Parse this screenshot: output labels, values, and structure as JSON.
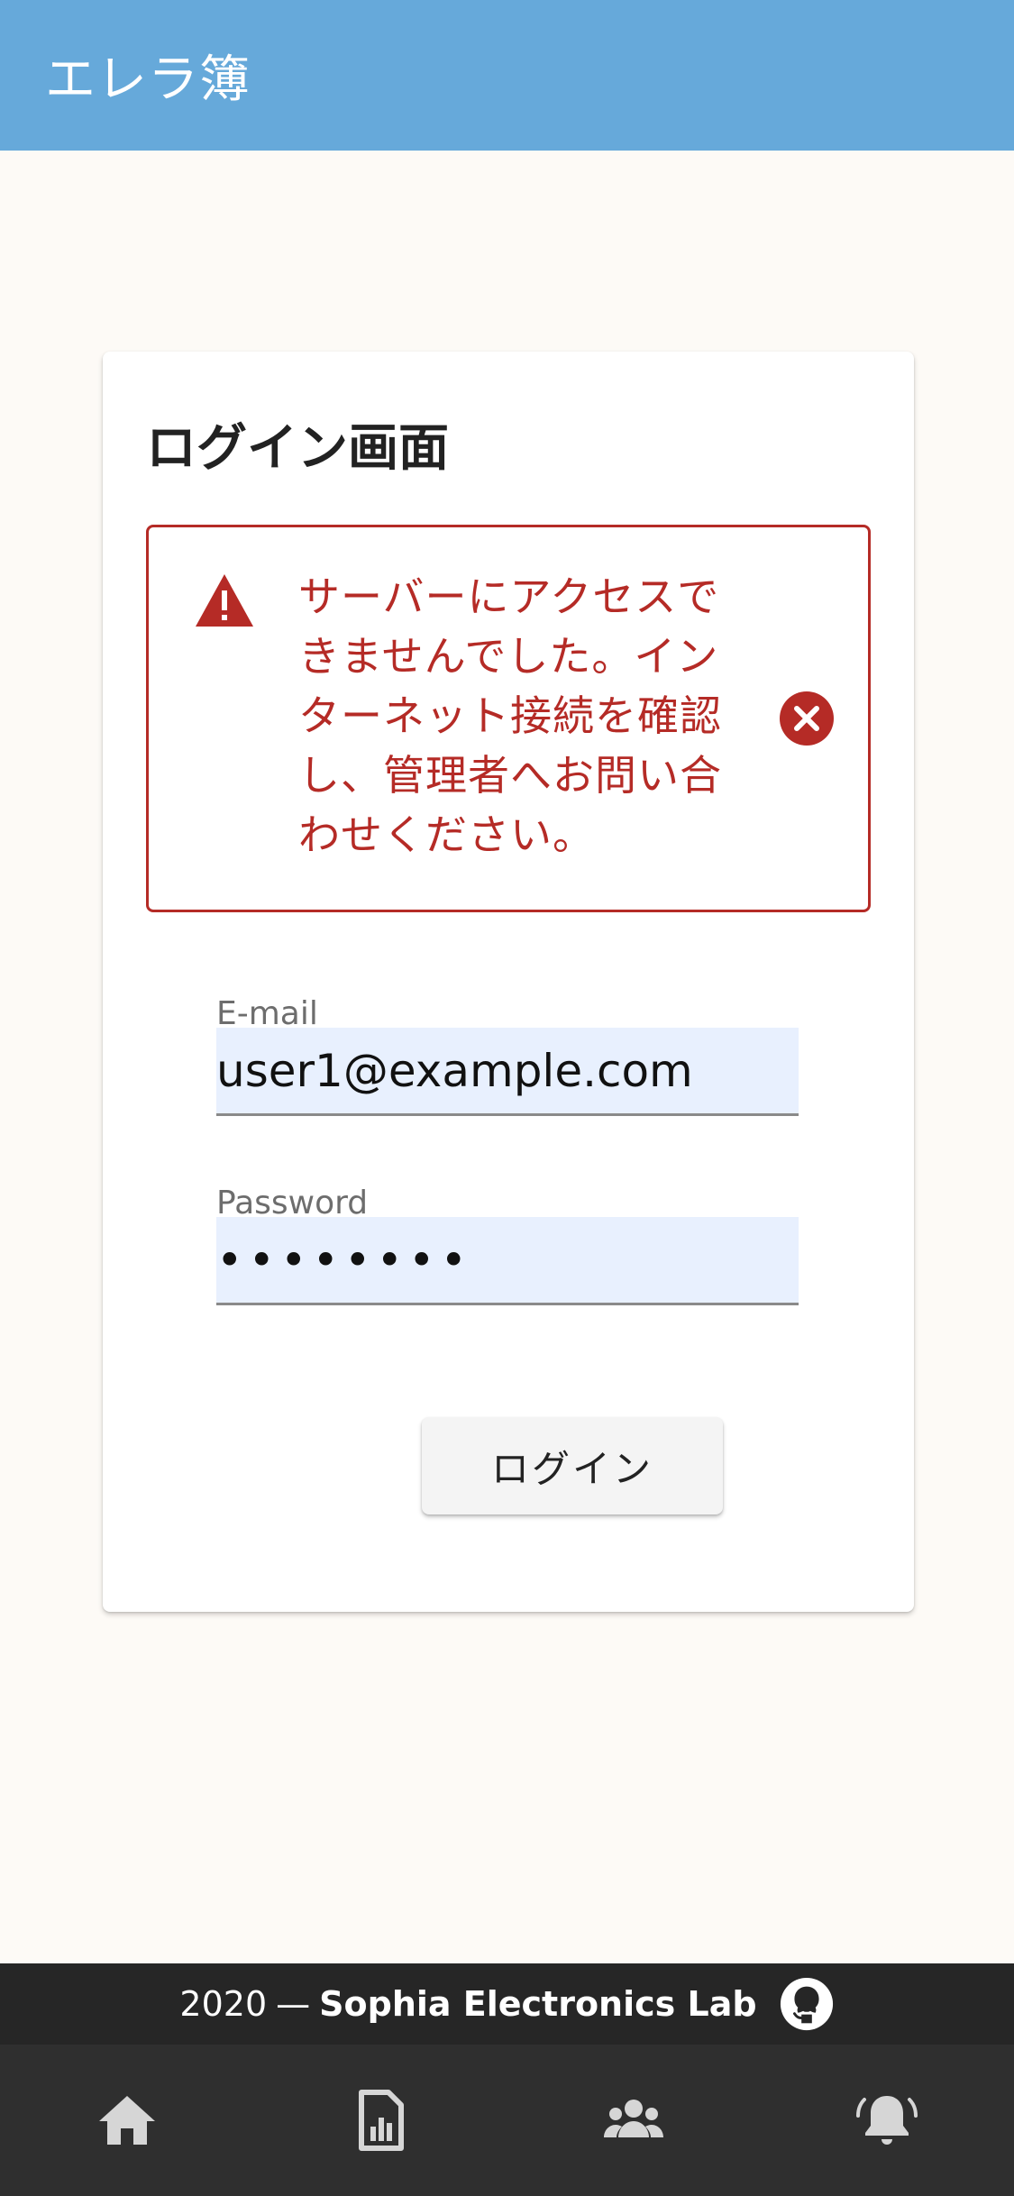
{
  "app_bar": {
    "title": "エレラ簿"
  },
  "login_card": {
    "title": "ログイン画面",
    "alert": {
      "message": "サーバーにアクセスできませんでした。インターネット接続を確認し、管理者へお問い合わせください。",
      "icon": "warning-icon",
      "close_icon": "close-circle-icon",
      "color": "#b52b26"
    },
    "email": {
      "label": "E-mail",
      "value": "user1@example.com"
    },
    "password": {
      "label": "Password",
      "value": "••••••••"
    },
    "submit_label": "ログイン"
  },
  "footer": {
    "year": "2020",
    "separator": "—",
    "lab": "Sophia Electronics Lab",
    "icon": "github-icon"
  },
  "bottom_nav": {
    "items": [
      {
        "name": "home",
        "icon": "home-icon"
      },
      {
        "name": "report",
        "icon": "report-icon"
      },
      {
        "name": "group",
        "icon": "group-icon"
      },
      {
        "name": "notifications",
        "icon": "bell-icon"
      }
    ]
  },
  "colors": {
    "app_bar": "#66a9da",
    "background": "#fdfaf6",
    "error": "#b52b26",
    "input_fill": "#e8f0fe",
    "footer": "#262626",
    "nav": "#2f2f2f",
    "nav_icon": "#d6d6d6"
  }
}
